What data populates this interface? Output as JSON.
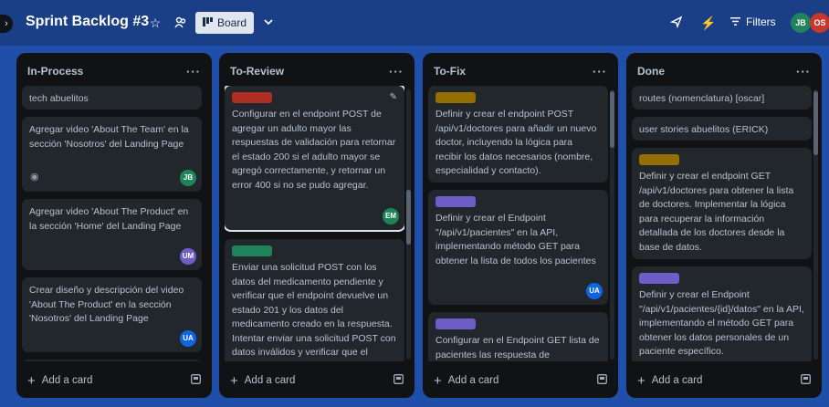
{
  "header": {
    "title": "Sprint Backlog #3",
    "view_label": "Board",
    "filters_label": "Filters",
    "members": [
      {
        "initials": "JB",
        "color": "#1f845a"
      },
      {
        "initials": "OS",
        "color": "#c9372c"
      }
    ]
  },
  "lists": [
    {
      "title": "In-Process",
      "add_label": "Add a card",
      "cards": [
        {
          "text": "tech abuelitos"
        },
        {
          "text": "Agregar video 'About The Team' en la sección 'Nosotros' del Landing Page",
          "avatar": "JB",
          "avatar_color": "#1f845a"
        },
        {
          "text": "Agregar video 'About The Product' en la sección 'Home' del Landing Page",
          "avatar": "UM",
          "avatar_color": "#6e5dc6"
        },
        {
          "text": "Crear diseño y descripción del video 'About The Product' en la sección 'Nosotros' del Landing Page",
          "avatar": "UA",
          "avatar_color": "#0c66e4"
        }
      ]
    },
    {
      "title": "To-Review",
      "add_label": "Add a card",
      "cards": [
        {
          "label_color": "#ae2e24",
          "text": "Configurar en el endpoint POST de agregar un adulto mayor las respuestas de validación para retornar el estado 200 si el adulto mayor se agregó correctamente, y retornar un error 400 si no se pudo agregar.",
          "avatar": "EM",
          "avatar_color": "#1f845a"
        },
        {
          "label_color": "#1f845a",
          "text": "Enviar una solicitud POST con los datos del medicamento pendiente y verificar que el endpoint devuelve un estado 201 y los datos del medicamento creado en la respuesta. Intentar enviar una solicitud POST con datos inválidos y verificar que el endpoint devuelve"
        }
      ]
    },
    {
      "title": "To-Fix",
      "add_label": "Add a card",
      "cards": [
        {
          "label_color": "#946f00",
          "text": "Definir y crear el endpoint POST /api/v1/doctores para añadir un nuevo doctor, incluyendo la lógica para recibir los datos necesarios (nombre, especialidad y contacto)."
        },
        {
          "label_color": "#6e5dc6",
          "text": "Definir y crear el Endpoint \"/api/v1/pacientes\" en la API, implementando método GET para obtener la lista de todos los pacientes",
          "avatar": "UA",
          "avatar_color": "#0c66e4"
        },
        {
          "label_color": "#6e5dc6",
          "text": "Configurar en el Endpoint GET lista de pacientes las respuesta de"
        }
      ]
    },
    {
      "title": "Done",
      "add_label": "Add a card",
      "cards": [
        {
          "text": "routes (nomenclatura) [oscar]"
        },
        {
          "text": "user stories abuelitos (ERICK)"
        },
        {
          "label_color": "#946f00",
          "text": "Definir y crear el endpoint GET /api/v1/doctores para obtener la lista de doctores. Implementar la lógica para recuperar la información detallada de los doctores desde la base de datos."
        },
        {
          "label_color": "#6e5dc6",
          "text": "Definir y crear el Endpoint \"/api/v1/pacientes/{id}/datos\" en la API, implementando el método GET para obtener los datos personales de un paciente específico."
        }
      ]
    }
  ]
}
